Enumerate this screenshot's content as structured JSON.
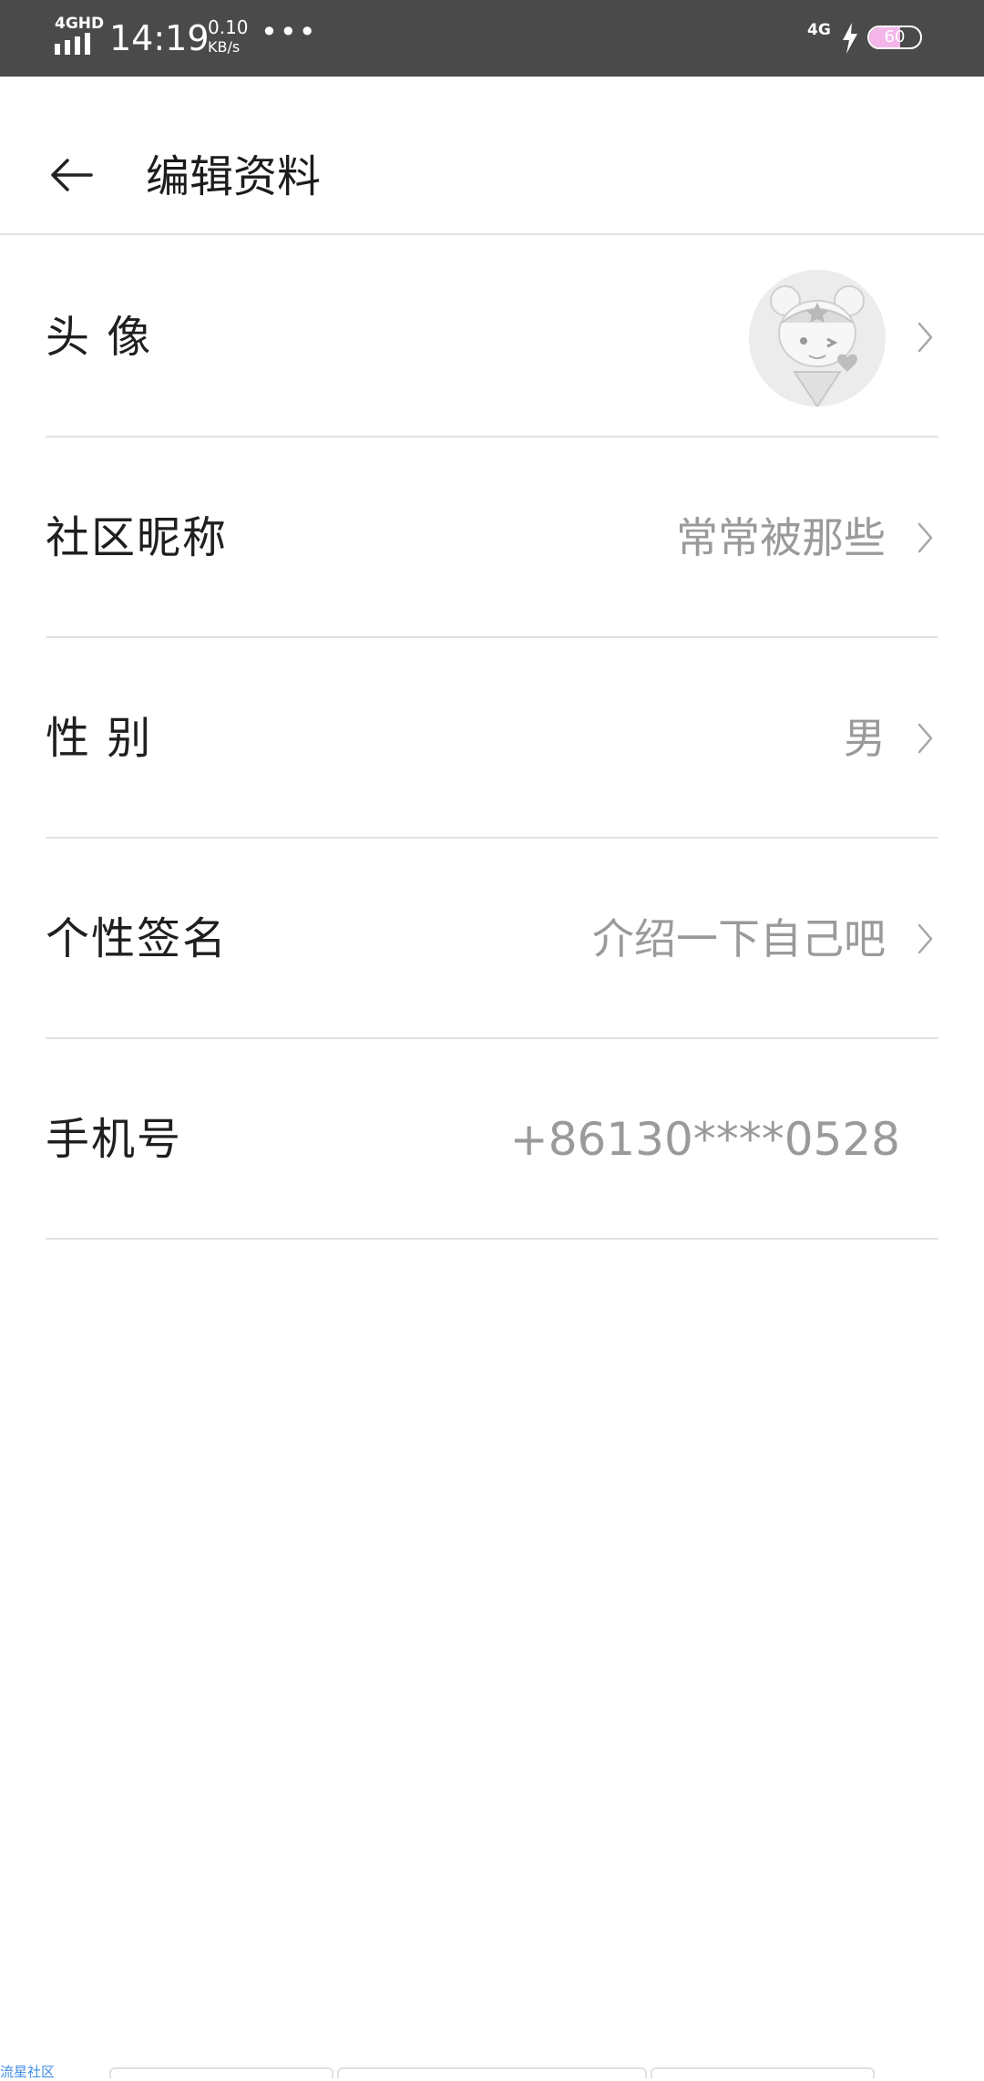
{
  "status_bar": {
    "network_type": "4GHD",
    "time": "14:19",
    "speed_value": "0.10",
    "speed_unit": "KB/s",
    "more": "•••",
    "right_network": "4G",
    "battery_level": 60,
    "battery_text": "60"
  },
  "header": {
    "title": "编辑资料"
  },
  "rows": {
    "avatar": {
      "label": "头 像"
    },
    "nickname": {
      "label": "社区昵称",
      "value": "常常被那些"
    },
    "gender": {
      "label": "性 别",
      "value": "男"
    },
    "signature": {
      "label": "个性签名",
      "value": "介绍一下自己吧"
    },
    "phone": {
      "label": "手机号",
      "value": "+86130****0528"
    }
  },
  "bottom": {
    "label": "流星社区"
  },
  "colors": {
    "status_bar_bg": "#4a4a4a",
    "value_text": "#9a9a9a",
    "divider": "#e2e2e2",
    "battery_fill": "#f4b6e8"
  }
}
